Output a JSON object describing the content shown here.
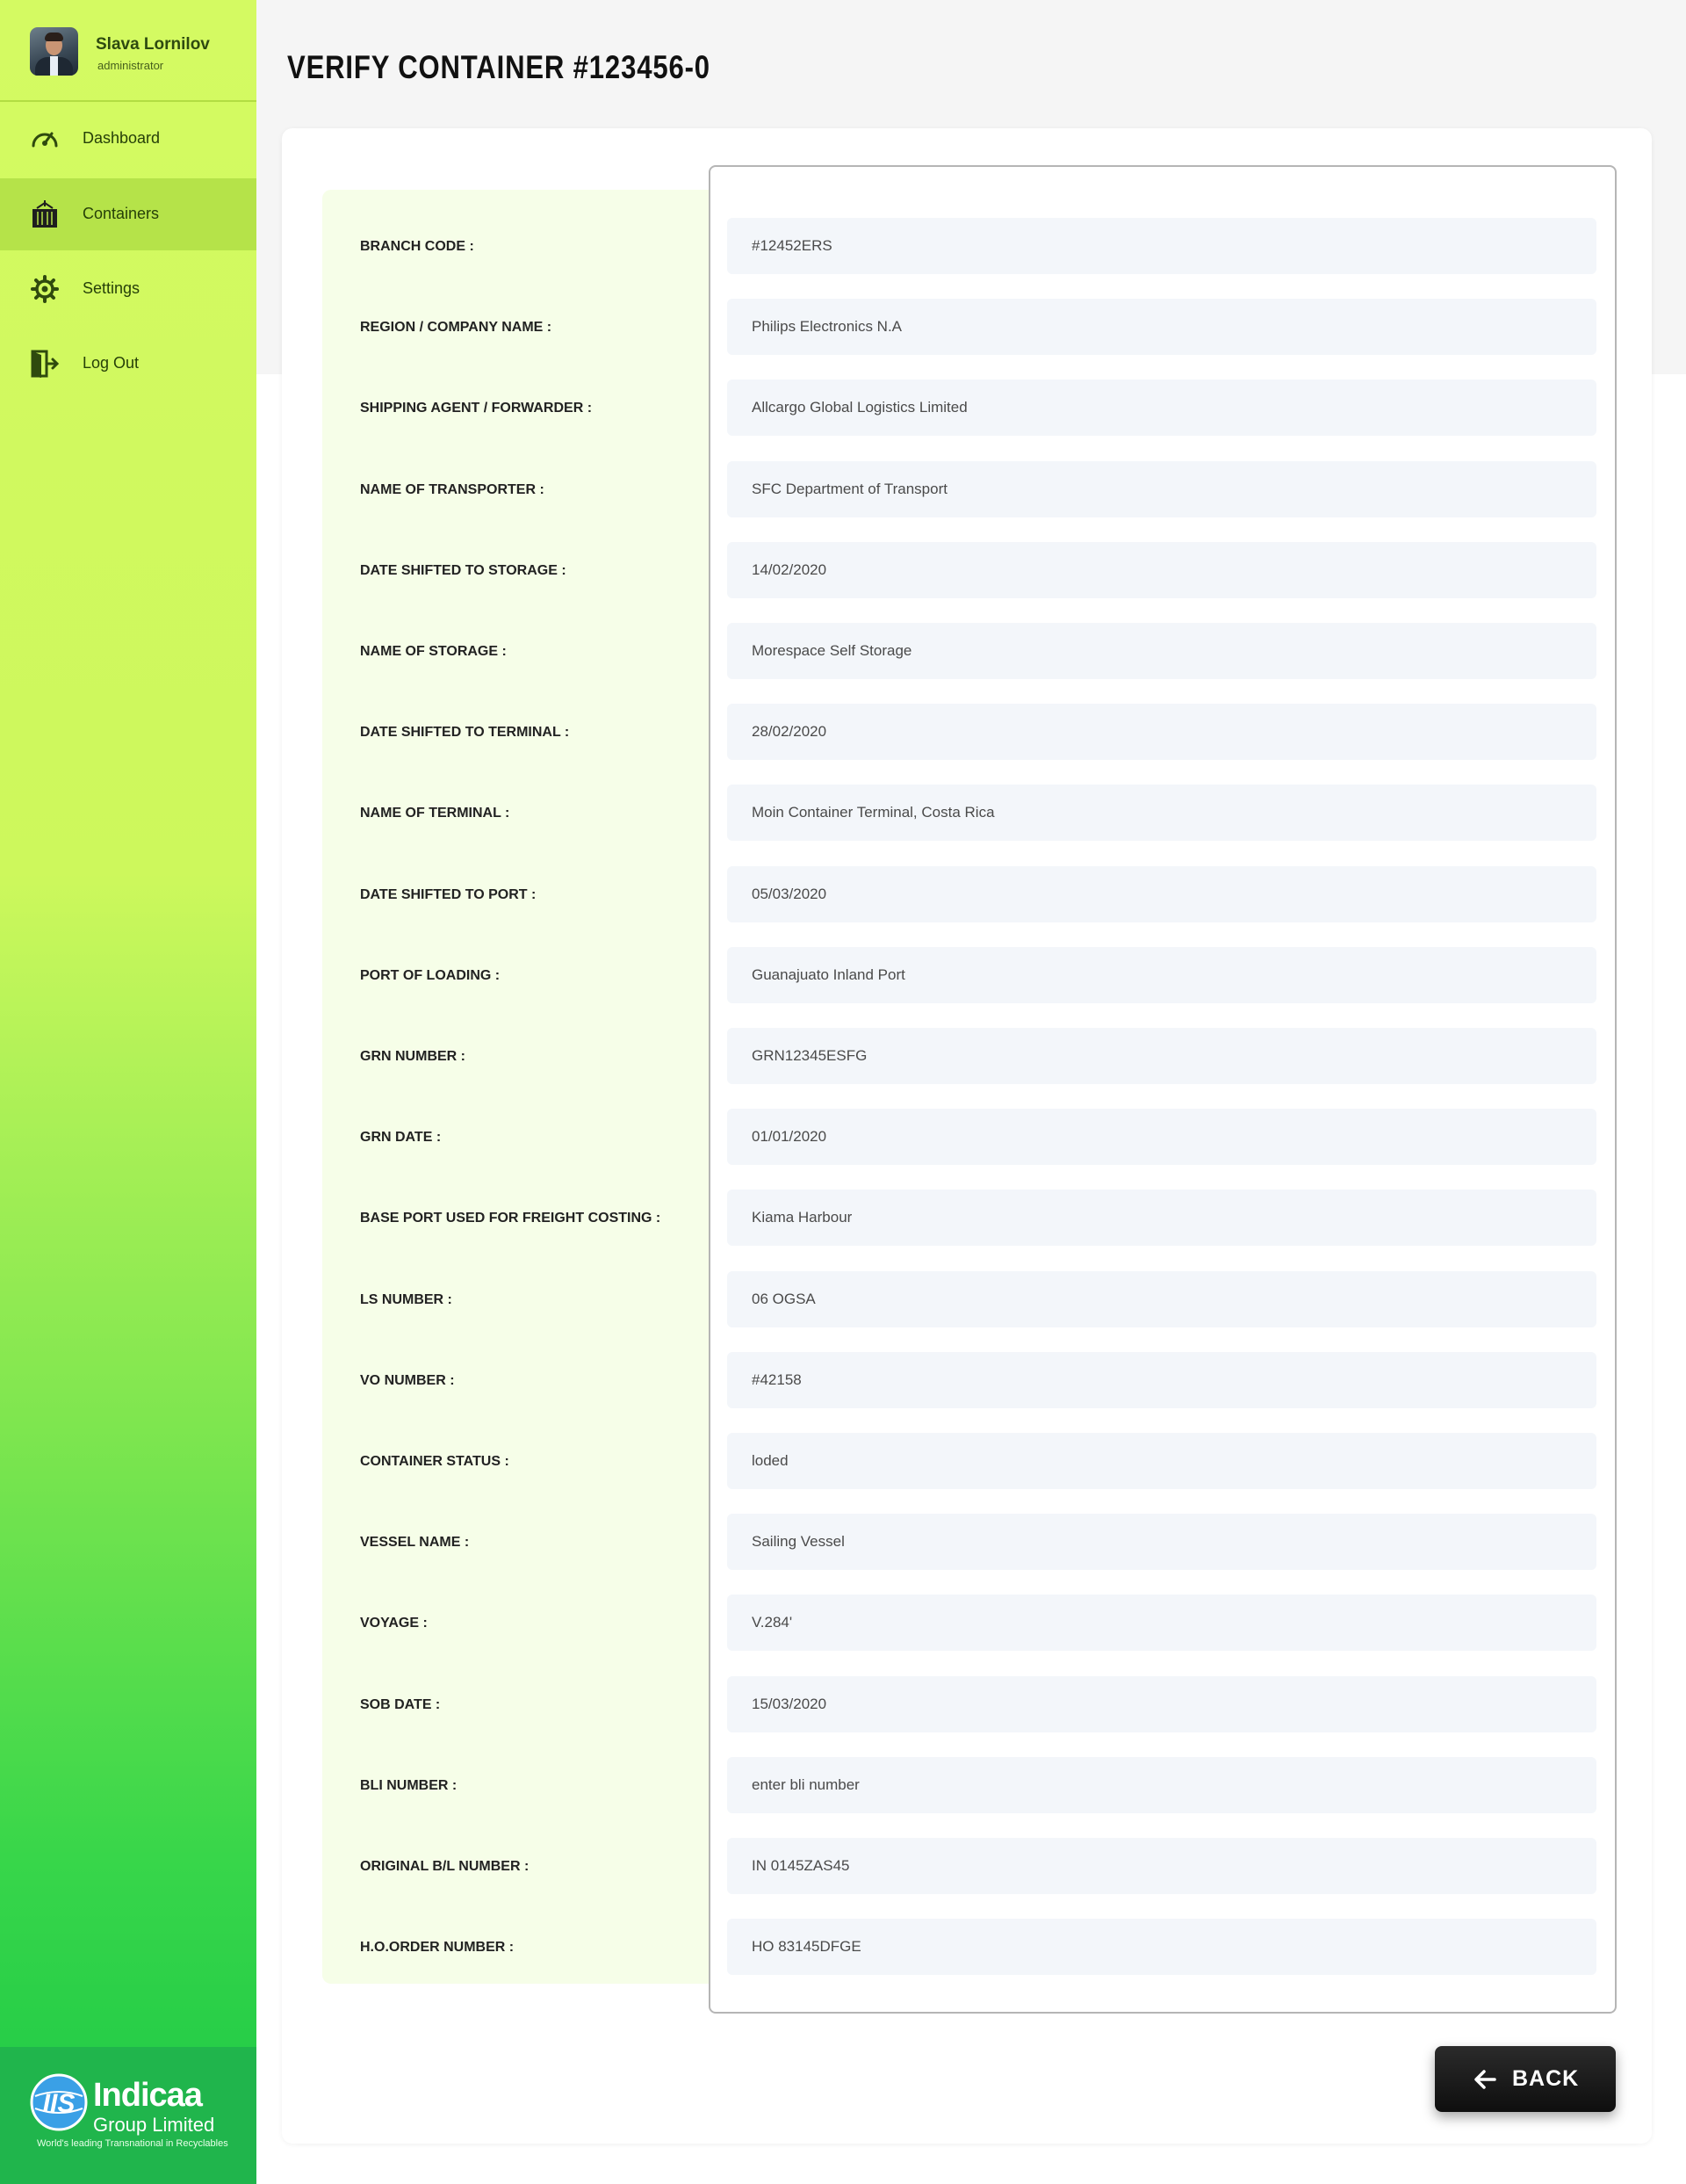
{
  "user": {
    "name": "Slava Lornilov",
    "role": "administrator",
    "avatar_icon": "user-avatar"
  },
  "sidebar": {
    "items": [
      {
        "label": "Dashboard",
        "icon": "speedometer-icon",
        "active": false
      },
      {
        "label": "Containers",
        "icon": "container-icon",
        "active": true
      },
      {
        "label": "Settings",
        "icon": "gear-icon",
        "active": false
      },
      {
        "label": "Log Out",
        "icon": "logout-icon",
        "active": false
      }
    ]
  },
  "brand": {
    "name": "Indicaa",
    "subtitle": "Group Limited",
    "tagline": "World's leading Transnational in Recyclables",
    "logo_monogram": "IIS"
  },
  "page": {
    "title": "VERIFY CONTAINER #123456-0"
  },
  "fields": [
    {
      "label": "BRANCH CODE :",
      "value": "#12452ERS"
    },
    {
      "label": "REGION / COMPANY NAME :",
      "value": "Philips Electronics N.A"
    },
    {
      "label": "SHIPPING AGENT / FORWARDER :",
      "value": "Allcargo Global Logistics Limited"
    },
    {
      "label": "NAME OF TRANSPORTER :",
      "value": "SFC Department of Transport"
    },
    {
      "label": "DATE SHIFTED TO STORAGE :",
      "value": "14/02/2020"
    },
    {
      "label": "NAME OF STORAGE :",
      "value": "Morespace Self Storage"
    },
    {
      "label": "DATE SHIFTED TO TERMINAL :",
      "value": "28/02/2020"
    },
    {
      "label": "NAME OF TERMINAL :",
      "value": "Moin Container Terminal, Costa Rica"
    },
    {
      "label": "DATE SHIFTED TO PORT :",
      "value": "05/03/2020"
    },
    {
      "label": "PORT OF LOADING :",
      "value": "Guanajuato Inland Port"
    },
    {
      "label": "GRN NUMBER :",
      "value": "GRN12345ESFG"
    },
    {
      "label": "GRN DATE :",
      "value": "01/01/2020"
    },
    {
      "label": "BASE PORT USED FOR FREIGHT COSTING :",
      "value": "Kiama Harbour"
    },
    {
      "label": "LS NUMBER :",
      "value": "06 OGSA"
    },
    {
      "label": "VO NUMBER :",
      "value": "#42158"
    },
    {
      "label": "CONTAINER STATUS :",
      "value": "loded"
    },
    {
      "label": "VESSEL NAME :",
      "value": "Sailing Vessel"
    },
    {
      "label": "VOYAGE :",
      "value": "V.284'"
    },
    {
      "label": "SOB DATE :",
      "value": "15/03/2020"
    },
    {
      "label": "BLI NUMBER :",
      "value": "enter bli number"
    },
    {
      "label": "ORIGINAL B/L NUMBER :",
      "value": "IN 0145ZAS45"
    },
    {
      "label": "H.O.ORDER NUMBER :",
      "value": "HO 83145DFGE"
    }
  ],
  "actions": {
    "back_label": "BACK",
    "back_icon": "arrow-left-icon"
  },
  "colors": {
    "sidebar_top": "#d4fa62",
    "sidebar_bottom": "#1bc846",
    "active_item": "#b5e349",
    "label_panel": "#f6fee8",
    "field_bg": "#f3f6fa",
    "button_bg": "#1a1a1a"
  }
}
